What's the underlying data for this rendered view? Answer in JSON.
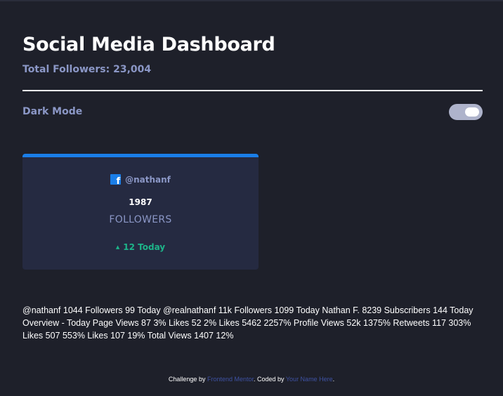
{
  "header": {
    "title": "Social Media Dashboard",
    "total_followers": "Total Followers: 23,004"
  },
  "theme": {
    "label": "Dark Mode",
    "toggle_on": true
  },
  "card": {
    "platform_icon": "facebook-icon",
    "accent_color": "#1a7ee8",
    "handle": "@nathanf",
    "count": "1987",
    "unit": "FOLLOWERS",
    "today_arrow": "▲",
    "today": "12 Today",
    "today_color": "#1db489"
  },
  "raw_text": "@nathanf 1044 Followers 99 Today @realnathanf 11k Followers 1099 Today Nathan F. 8239 Subscribers 144 Today Overview - Today Page Views 87 3% Likes 52 2% Likes 5462 2257% Profile Views 52k 1375% Retweets 117 303% Likes 507 553% Likes 107 19% Total Views 1407 12%",
  "footer": {
    "prefix": "Challenge by ",
    "link1": "Frontend Mentor",
    "middle": ". Coded by ",
    "link2": "Your Name Here",
    "suffix": "."
  }
}
